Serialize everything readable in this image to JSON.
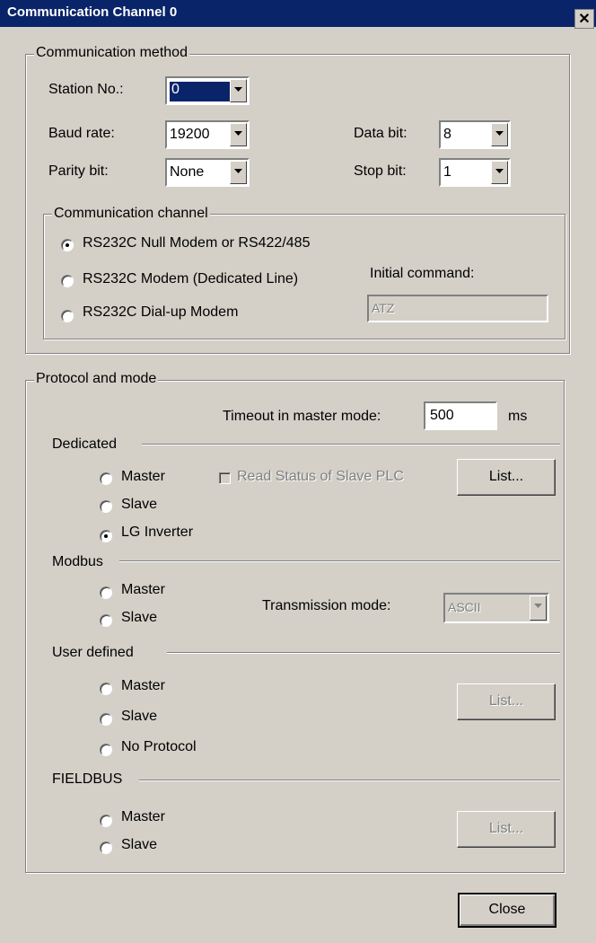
{
  "window": {
    "title": "Communication Channel 0",
    "close_glyph": "✕"
  },
  "comm_method": {
    "legend": "Communication method",
    "station_label": "Station No.:",
    "station_value": "0",
    "baud_label": "Baud rate:",
    "baud_value": "19200",
    "databit_label": "Data bit:",
    "databit_value": "8",
    "parity_label": "Parity bit:",
    "parity_value": "None",
    "stopbit_label": "Stop bit:",
    "stopbit_value": "1",
    "channel": {
      "legend": "Communication channel",
      "options": [
        "RS232C Null Modem or RS422/485",
        "RS232C Modem (Dedicated Line)",
        "RS232C Dial-up Modem"
      ],
      "selected": 0,
      "initial_command_label": "Initial command:",
      "initial_command_value": "ATZ"
    }
  },
  "protocol": {
    "legend": "Protocol and mode",
    "timeout_label": "Timeout in master mode:",
    "timeout_value": "500",
    "timeout_unit": "ms",
    "dedicated": {
      "label": "Dedicated",
      "master": "Master",
      "slave": "Slave",
      "lg_inverter": "LG Inverter",
      "read_status": "Read Status of Slave PLC",
      "list_button": "List..."
    },
    "modbus": {
      "label": "Modbus",
      "master": "Master",
      "slave": "Slave",
      "transmission_label": "Transmission mode:",
      "transmission_value": "ASCII"
    },
    "user_defined": {
      "label": "User defined",
      "master": "Master",
      "slave": "Slave",
      "no_protocol": "No Protocol",
      "list_button": "List..."
    },
    "fieldbus": {
      "label": "FIELDBUS",
      "master": "Master",
      "slave": "Slave",
      "list_button": "List..."
    }
  },
  "close_button": "Close",
  "colors": {
    "face": "#d4d0c8",
    "title_bar": "#0a246a",
    "selection": "#0a246a",
    "disabled_text": "#808080"
  },
  "icons": {
    "dropdown": "chevron-down-icon",
    "window_close": "close-icon"
  }
}
